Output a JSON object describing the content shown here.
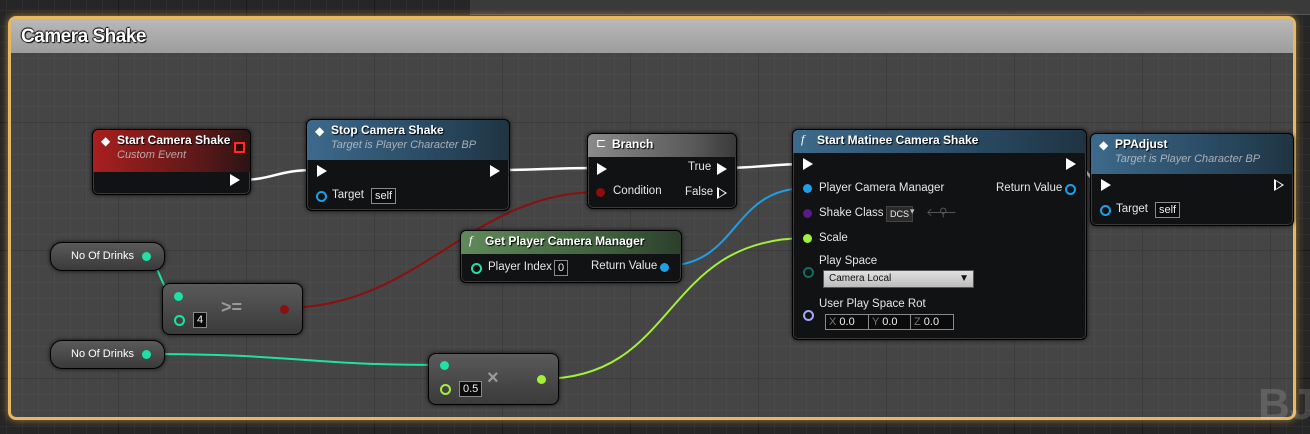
{
  "comment": {
    "title": "Camera Shake"
  },
  "nodes": {
    "start_event": {
      "title": "Start Camera Shake",
      "subtitle": "Custom Event"
    },
    "stop_shake": {
      "title": "Stop Camera Shake",
      "subtitle": "Target is Player Character BP",
      "target_label": "Target",
      "target_value": "self"
    },
    "branch": {
      "title": "Branch",
      "condition_label": "Condition",
      "true_label": "True",
      "false_label": "False"
    },
    "get_cam_mgr": {
      "title": "Get Player Camera Manager",
      "player_index_label": "Player Index",
      "player_index_value": "0",
      "return_label": "Return Value"
    },
    "matinee": {
      "title": "Start Matinee Camera Shake",
      "pcm_label": "Player Camera Manager",
      "shake_class_label": "Shake Class",
      "shake_class_value": "DCS",
      "scale_label": "Scale",
      "play_space_label": "Play Space",
      "play_space_value": "Camera Local",
      "rot_label": "User Play Space Rot",
      "rot_x_label": "X",
      "rot_x": "0.0",
      "rot_y_label": "Y",
      "rot_y": "0.0",
      "rot_z_label": "Z",
      "rot_z": "0.0",
      "return_label": "Return Value"
    },
    "ppadjust": {
      "title": "PPAdjust",
      "subtitle": "Target is Player Character BP",
      "target_label": "Target",
      "target_value": "self"
    },
    "var1": {
      "label": "No Of Drinks"
    },
    "var2": {
      "label": "No Of Drinks"
    },
    "gte": {
      "op": ">=",
      "value": "4"
    },
    "mul": {
      "op": "×",
      "value": "0.5"
    }
  },
  "watermark": "BJ",
  "colors": {
    "exec": "#ffffff",
    "bool": "#8c0f0f",
    "int": "#1fe0a5",
    "float": "#a2f03a",
    "object": "#1e9fe5",
    "class": "#5a1a8c",
    "byte": "#0d6d61",
    "rotator": "#9ea8f5",
    "comment_border": "#e8b860"
  }
}
